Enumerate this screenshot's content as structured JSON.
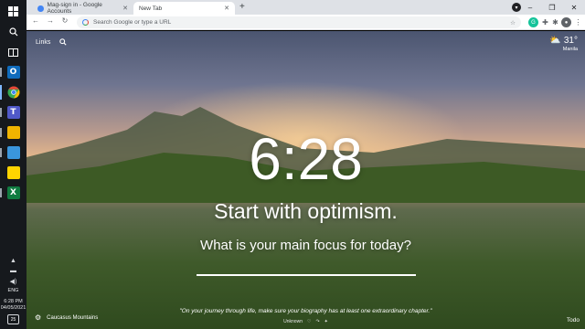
{
  "taskbar": {
    "apps": [
      {
        "name": "outlook",
        "letter": "O",
        "color": "#0f6cbd"
      },
      {
        "name": "chrome",
        "letter": "",
        "color": "#e94235"
      },
      {
        "name": "teams",
        "letter": "T",
        "color": "#5059c9"
      },
      {
        "name": "photos",
        "letter": "",
        "color": "#f0b400"
      },
      {
        "name": "word",
        "letter": "",
        "color": "#3a96dd"
      },
      {
        "name": "sticky-notes",
        "letter": "",
        "color": "#ffd400"
      },
      {
        "name": "excel",
        "letter": "X",
        "color": "#107c41"
      }
    ],
    "language": "ENG",
    "time": "6:28 PM",
    "date": "04/05/2021",
    "notification_count": "25"
  },
  "chrome": {
    "tabs": [
      {
        "title": "Mag-sign in - Google Accounts",
        "active": false
      },
      {
        "title": "New Tab",
        "active": true
      }
    ],
    "omnibox_placeholder": "Search Google or type a URL"
  },
  "ntp": {
    "links_label": "Links",
    "weather": {
      "temp": "31°",
      "location": "Manila"
    },
    "clock": "6:28",
    "greeting": "Start with optimism.",
    "focus_question": "What is your main focus for today?",
    "photo_location": "Caucasus Mountains",
    "quote": "\"On your journey through life, make sure your biography has at least one extraordinary chapter.\"",
    "quote_author": "Unknown",
    "todo_label": "Todo"
  }
}
